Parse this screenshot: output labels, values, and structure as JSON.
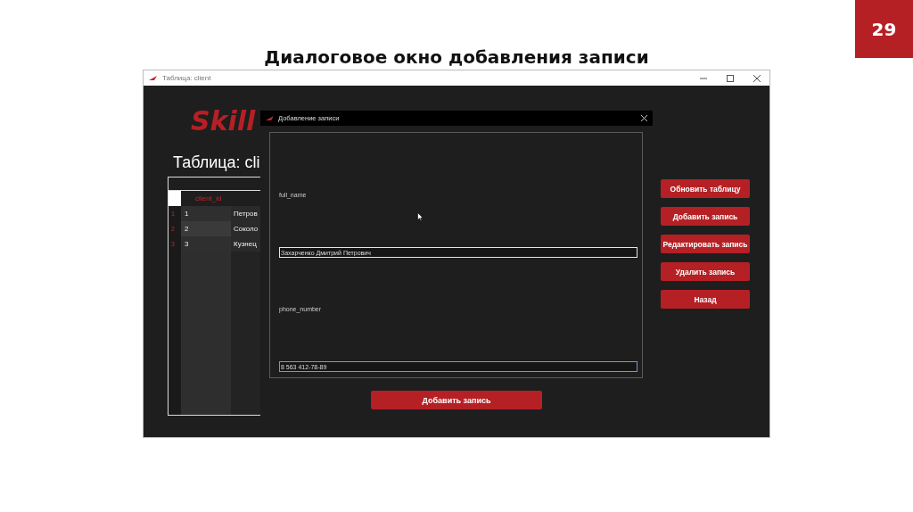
{
  "slide_number": "29",
  "slide_title": "Диалоговое окно добавления записи",
  "window": {
    "title": "Таблица: client"
  },
  "app": {
    "logo": "Skill",
    "table_title": "Таблица: cli",
    "table": {
      "columns": [
        "client_id"
      ],
      "rows": [
        {
          "number": "1",
          "id": "1",
          "name": "Петров"
        },
        {
          "number": "2",
          "id": "2",
          "name": "Соколо"
        },
        {
          "number": "3",
          "id": "3",
          "name": "Кузнец"
        }
      ]
    },
    "buttons": [
      "Обновить таблицу",
      "Добавить запись",
      "Редактировать запись",
      "Удалить запись",
      "Назад"
    ]
  },
  "dialog": {
    "title": "Добавление записи",
    "fields": [
      {
        "label": "full_name",
        "value": "Захарченко Дмитрий Петрович",
        "focused": false
      },
      {
        "label": "phone_number",
        "value": "8 563 412-78-89",
        "focused": true
      }
    ],
    "submit": "Добавить запись"
  }
}
